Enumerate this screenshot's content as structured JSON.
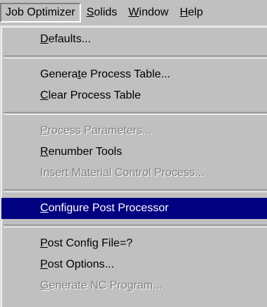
{
  "menubar": {
    "items": [
      {
        "label": "Job Optimizer",
        "active": true
      },
      {
        "label": "Solids"
      },
      {
        "label": "Window"
      },
      {
        "label": "Help"
      }
    ]
  },
  "menu": {
    "groups": [
      [
        {
          "label": "Defaults...",
          "accel_index": 0
        }
      ],
      [
        {
          "label": "Generate Process Table...",
          "accel_index": 6
        },
        {
          "label": "Clear Process Table",
          "accel_index": 0
        }
      ],
      [
        {
          "label": "Process Parameters...",
          "accel_index": 0,
          "disabled": true
        },
        {
          "label": "Renumber Tools",
          "accel_index": 0
        },
        {
          "label": "Insert Material Control Process...",
          "disabled": true
        }
      ],
      [
        {
          "label": "Configure Post Processor",
          "accel_index": 0,
          "highlighted": true
        }
      ],
      [
        {
          "label": "Post Config File=?",
          "accel_index": 0
        },
        {
          "label": "Post Options...",
          "accel_index": 0
        },
        {
          "label": "Generate NC Program...",
          "accel_index": 0,
          "disabled": true
        }
      ]
    ]
  },
  "colors": {
    "face": "#c0c0c0",
    "highlight": "#000080",
    "disabled_text": "#808080"
  }
}
